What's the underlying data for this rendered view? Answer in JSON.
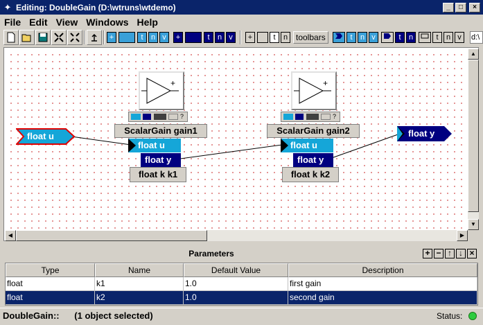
{
  "window": {
    "title": "Editing:  DoubleGain  (D:\\wtruns\\wtdemo)",
    "app_icon": "wt-icon",
    "minimize": "_",
    "maximize": "□",
    "close": "×"
  },
  "menu": [
    "File",
    "Edit",
    "View",
    "Windows",
    "Help"
  ],
  "toolbar": {
    "buttons": [
      "new-icon",
      "open-icon",
      "save-icon",
      "shrink-icon",
      "expand-icon",
      "up-icon"
    ],
    "plus": "+",
    "t": "t",
    "n": "n",
    "v": "v",
    "toolbars_label": "toolbars",
    "path_field": "d:\\"
  },
  "canvas": {
    "inputs": [
      {
        "label": "float u",
        "color": "#15a6d8"
      }
    ],
    "outputs": [
      {
        "label": "float y",
        "color": "#000080"
      }
    ],
    "blocks": [
      {
        "name": "ScalarGain  gain1",
        "in_port": "float u",
        "out_port": "float y",
        "param": "float k k1",
        "icon": "gain-triangle-icon",
        "plus_sign": "+",
        "help": "?"
      },
      {
        "name": "ScalarGain  gain2",
        "in_port": "float u",
        "out_port": "float y",
        "param": "float k k2",
        "icon": "gain-triangle-icon",
        "plus_sign": "+",
        "help": "?"
      }
    ]
  },
  "parameters": {
    "title": "Parameters",
    "controls": [
      "+",
      "−",
      "↑",
      "↓",
      "×"
    ],
    "columns": [
      "Type",
      "Name",
      "Default Value",
      "Description"
    ],
    "rows": [
      {
        "type": "float",
        "name": "k1",
        "default": "1.0",
        "description": "first gain",
        "selected": false
      },
      {
        "type": "float",
        "name": "k2",
        "default": "1.0",
        "description": "second gain",
        "selected": true
      }
    ]
  },
  "status": {
    "left": "DoubleGain::      (1 object selected)",
    "label": "Status:",
    "led_color": "#2ecc40"
  }
}
